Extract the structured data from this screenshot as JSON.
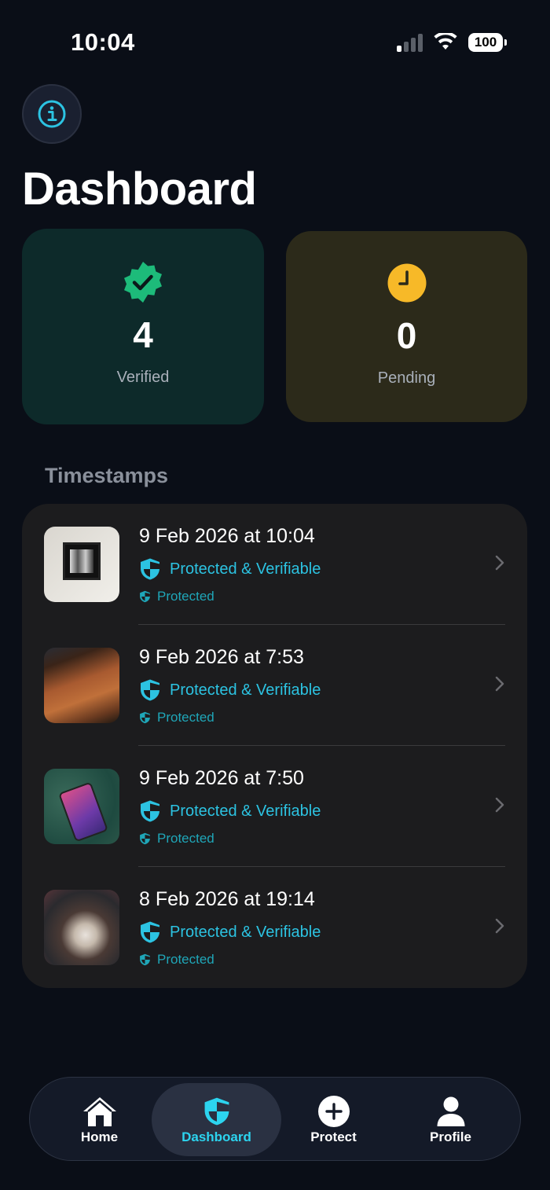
{
  "status_bar": {
    "time": "10:04",
    "battery": "100"
  },
  "header": {
    "title": "Dashboard"
  },
  "stats": {
    "verified": {
      "value": "4",
      "label": "Verified"
    },
    "pending": {
      "value": "0",
      "label": "Pending"
    }
  },
  "section": {
    "title": "Timestamps"
  },
  "timestamps": [
    {
      "date": "9 Feb 2026 at 10:04",
      "status": "Protected & Verifiable",
      "badge": "Protected"
    },
    {
      "date": "9 Feb 2026 at 7:53",
      "status": "Protected & Verifiable",
      "badge": "Protected"
    },
    {
      "date": "9 Feb 2026 at 7:50",
      "status": "Protected & Verifiable",
      "badge": "Protected"
    },
    {
      "date": "8 Feb 2026 at 19:14",
      "status": "Protected & Verifiable",
      "badge": "Protected"
    }
  ],
  "tabbar": {
    "home": "Home",
    "dashboard": "Dashboard",
    "protect": "Protect",
    "profile": "Profile",
    "active": "dashboard"
  },
  "colors": {
    "accent": "#2cc3e2",
    "verified": "#1dbb7a",
    "pending": "#f7b928",
    "background": "#0a0e17"
  }
}
